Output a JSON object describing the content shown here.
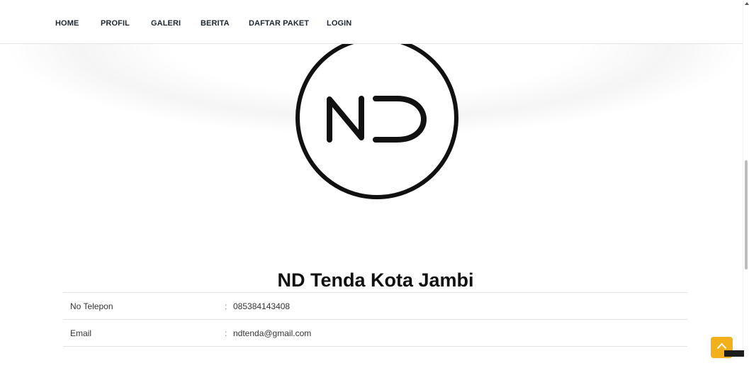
{
  "nav": {
    "items": [
      {
        "label": "HOME"
      },
      {
        "label": "PROFIL"
      },
      {
        "label": "GALERI"
      },
      {
        "label": "BERITA"
      },
      {
        "label": "DAFTAR PAKET"
      },
      {
        "label": "LOGIN"
      }
    ]
  },
  "logo": {
    "text": "ND",
    "icon": "nd-circle-logo"
  },
  "business": {
    "name": "ND Tenda Kota Jambi"
  },
  "info": {
    "rows": [
      {
        "label": "No Telepon",
        "separator": ":",
        "value": "085384143408"
      },
      {
        "label": "Email",
        "separator": ":",
        "value": "ndtenda@gmail.com"
      }
    ]
  },
  "colors": {
    "nav_text": "#1c2733",
    "accent": "#f2b01b",
    "title": "#111111"
  },
  "icons": {
    "back_to_top": "chevron-up-icon",
    "scroll_up": "scroll-up-arrow-icon"
  }
}
